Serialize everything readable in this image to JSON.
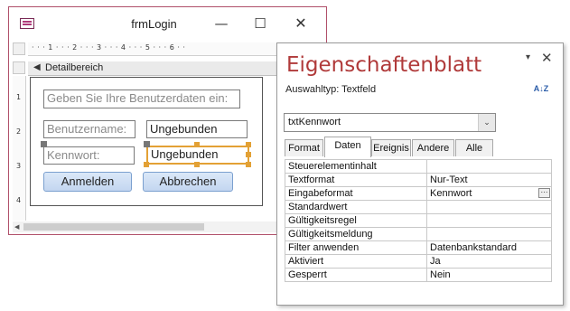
{
  "form_window": {
    "title": "frmLogin",
    "minimize_glyph": "—",
    "maximize_glyph": "☐",
    "close_glyph": "✕",
    "ruler_h_label": "· · · 1 · · · 2 · · · 3 · · · 4 · · · 5 · · · 6 · ·",
    "ruler_v_labels": [
      "1",
      "2",
      "3",
      "4"
    ],
    "section_arrow": "◀",
    "section_label": "Detailbereich",
    "controls": {
      "heading_label": "Geben Sie Ihre Benutzerdaten ein:",
      "username_label": "Benutzername:",
      "username_field": "Ungebunden",
      "password_label": "Kennwort:",
      "password_field": "Ungebunden",
      "login_button": "Anmelden",
      "cancel_button": "Abbrechen"
    }
  },
  "property_sheet": {
    "title": "Eigenschaftenblatt",
    "dropdown_glyph": "▾",
    "close_glyph": "✕",
    "selection_type_label": "Auswahltyp:  Textfeld",
    "sort_icon": "sort-az-icon",
    "sort_text": "A↓Z",
    "selected_object": "txtKennwort",
    "combo_arrow": "⌄",
    "tabs": [
      "Format",
      "Daten",
      "Ereignis",
      "Andere",
      "Alle"
    ],
    "active_tab": "Daten",
    "properties": [
      {
        "name": "Steuerelementinhalt",
        "value": ""
      },
      {
        "name": "Textformat",
        "value": "Nur-Text"
      },
      {
        "name": "Eingabeformat",
        "value": "Kennwort"
      },
      {
        "name": "Standardwert",
        "value": ""
      },
      {
        "name": "Gültigkeitsregel",
        "value": ""
      },
      {
        "name": "Gültigkeitsmeldung",
        "value": ""
      },
      {
        "name": "Filter anwenden",
        "value": "Datenbankstandard"
      },
      {
        "name": "Aktiviert",
        "value": "Ja"
      },
      {
        "name": "Gesperrt",
        "value": "Nein"
      }
    ],
    "ellipsis_label": "···"
  },
  "colors": {
    "window_border": "#b0506a",
    "property_title": "#b03a3a",
    "selection_handle": "#e3a135",
    "button_fill": "#c3d6f0"
  }
}
